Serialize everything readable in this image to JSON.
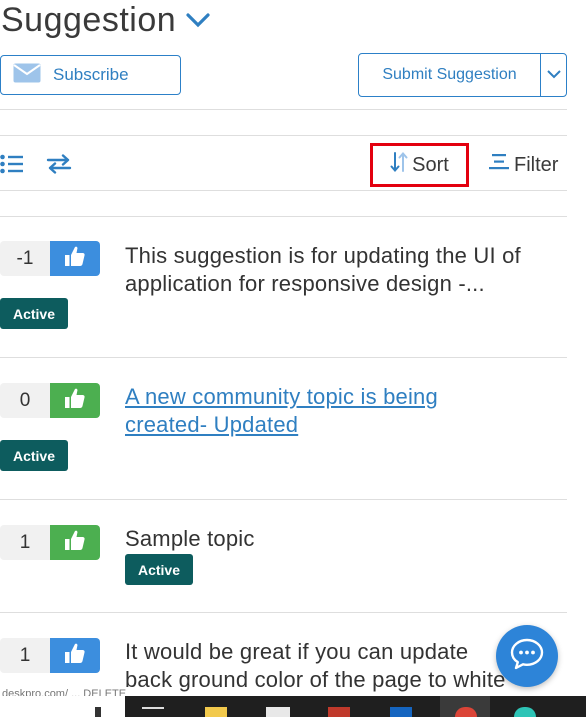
{
  "header": {
    "title": "Suggestion"
  },
  "actions": {
    "subscribe_label": "Subscribe",
    "submit_label": "Submit Suggestion"
  },
  "toolbar": {
    "sort_label": "Sort",
    "filter_label": "Filter"
  },
  "suggestions": [
    {
      "votes": "-1",
      "title_line1": "This suggestion is for updating the UI of",
      "title_line2": "application for responsive design -...",
      "status": "Active",
      "vote_color": "#3c8ede"
    },
    {
      "votes": "0",
      "title_line1": "A new community topic is being",
      "title_line2": "created- Updated",
      "status": "Active",
      "vote_color": "#4caf50"
    },
    {
      "votes": "1",
      "title_line1": "Sample topic",
      "status": "Active",
      "vote_color": "#4caf50"
    },
    {
      "votes": "1",
      "title_line1": "It would be great if you can update",
      "title_line2": "back ground color of the page to white",
      "vote_color": "#3c8ede"
    }
  ],
  "statusbar": {
    "text": "deskpro.com/ ... DELETE"
  },
  "colors": {
    "accent": "#2f7fc1",
    "badge": "#0d5c5e",
    "highlight": "#e3000f"
  }
}
